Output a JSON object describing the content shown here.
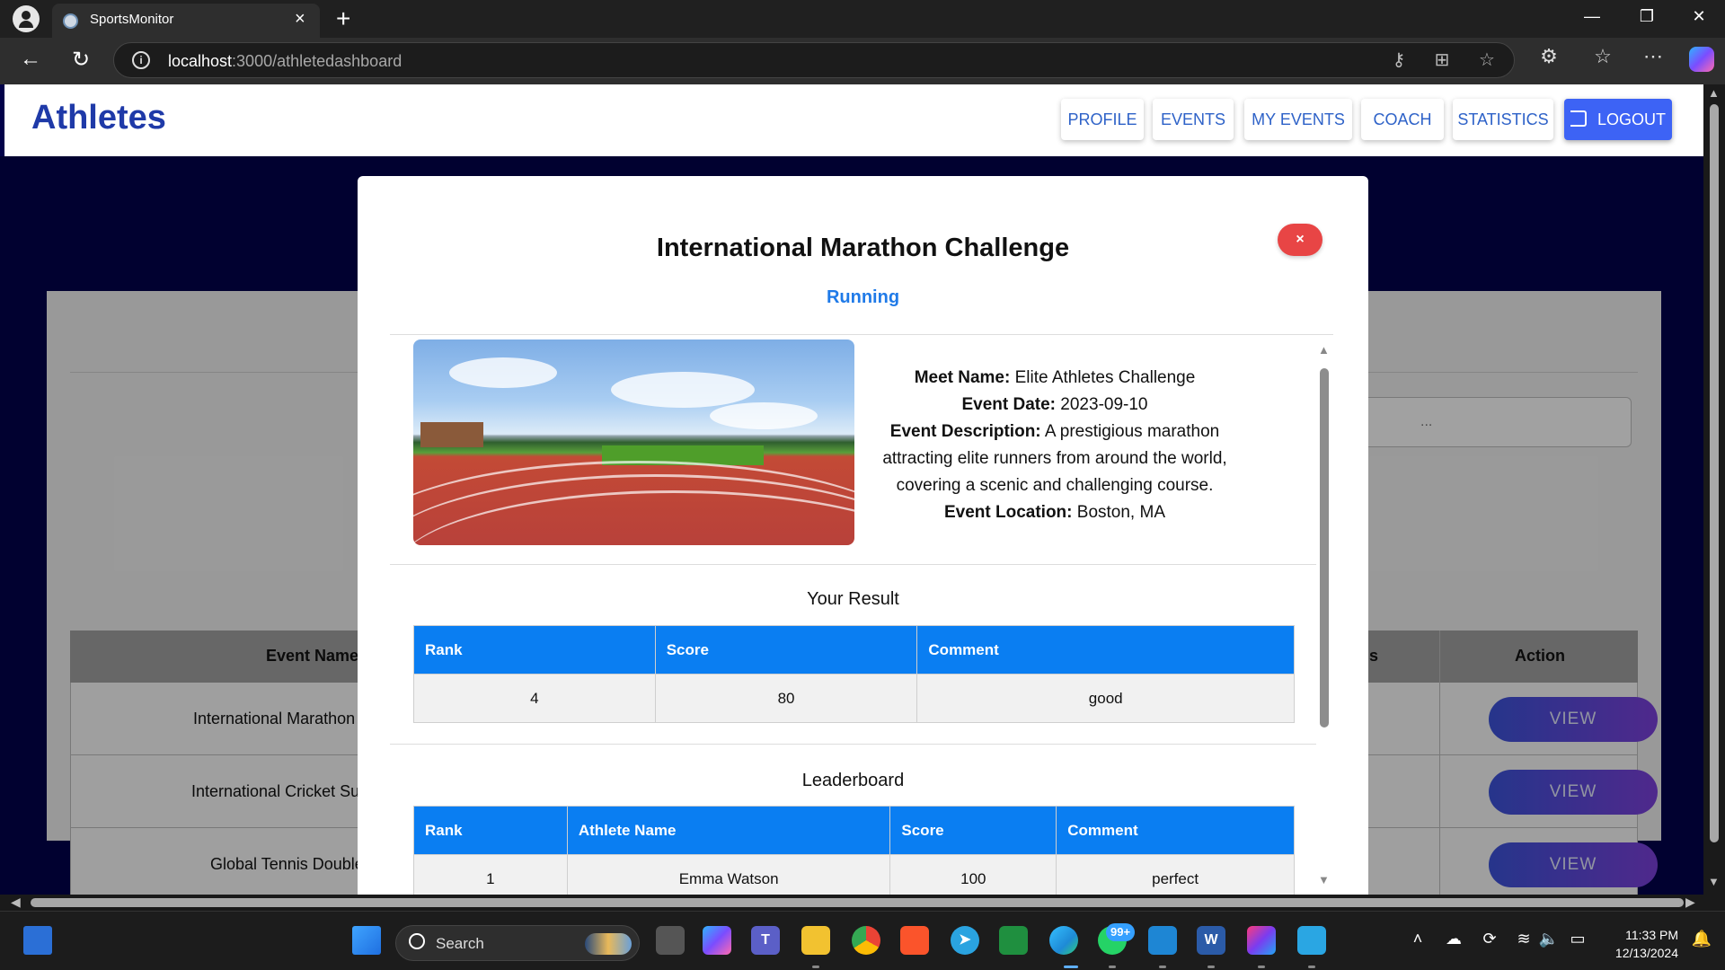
{
  "browser": {
    "tab_title": "SportsMonitor",
    "url_host": "localhost",
    "url_path": ":3000/athletedashboard"
  },
  "header": {
    "title": "Athletes",
    "nav": [
      "PROFILE",
      "EVENTS",
      "MY EVENTS",
      "COACH",
      "STATISTICS"
    ],
    "logout_label": "LOGOUT"
  },
  "background_table": {
    "search_placeholder_fragment": "...",
    "col_event_name": "Event Name",
    "col_partial": "s",
    "col_action": "Action",
    "rows": [
      "International Marathon",
      "International Cricket Su",
      "Global Tennis Double"
    ],
    "view_label": "VIEW"
  },
  "modal": {
    "title": "International Marathon Challenge",
    "sport": "Running",
    "close_label": "×",
    "details": {
      "meet_name_label": "Meet Name:",
      "meet_name": "Elite Athletes Challenge",
      "event_date_label": "Event Date:",
      "event_date": "2023-09-10",
      "description_label": "Event Description:",
      "description": "A prestigious marathon attracting elite runners from around the world, covering a scenic and challenging course.",
      "location_label": "Event Location:",
      "location": "Boston, MA"
    },
    "your_result": {
      "heading": "Your Result",
      "headers": [
        "Rank",
        "Score",
        "Comment"
      ],
      "row": [
        "4",
        "80",
        "good"
      ]
    },
    "leaderboard": {
      "heading": "Leaderboard",
      "headers": [
        "Rank",
        "Athlete Name",
        "Score",
        "Comment"
      ],
      "rows": [
        [
          "1",
          "Emma Watson",
          "100",
          "perfect"
        ]
      ]
    }
  },
  "taskbar": {
    "search_label": "Search",
    "whatsapp_badge": "99+",
    "time": "11:33 PM",
    "date": "12/13/2024"
  },
  "colors": {
    "accent_blue": "#0a7ef2",
    "title_blue": "#1f3aa8",
    "page_background": "#02024a",
    "close_red": "#e84545"
  }
}
